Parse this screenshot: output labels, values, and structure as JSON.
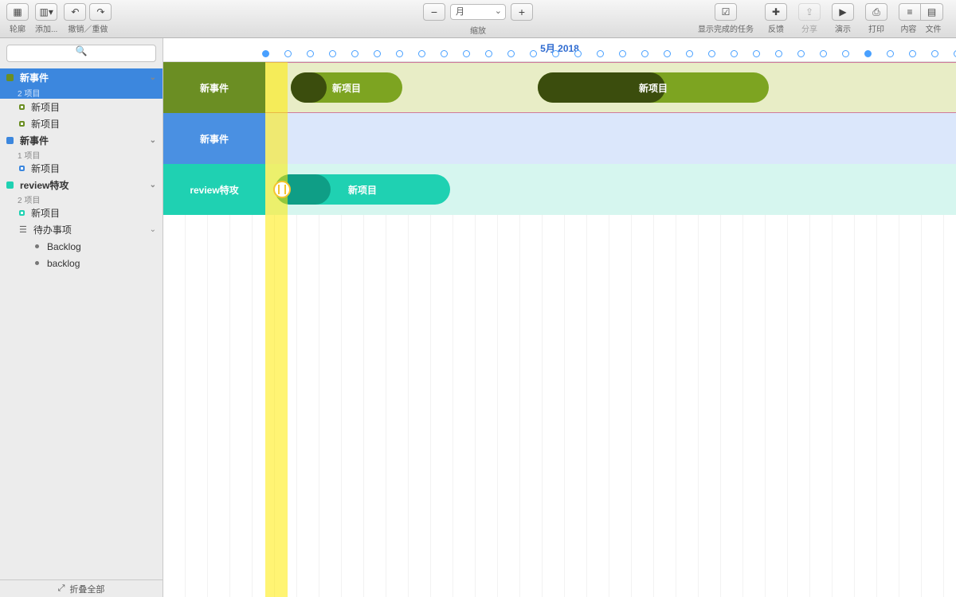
{
  "toolbar": {
    "outline_label": "轮廓",
    "add_label": "添加...",
    "undo_label": "撤销／重做",
    "zoom_label": "缩放",
    "zoom_value": "月",
    "show_completed_label": "显示完成的任务",
    "feedback_label": "反馈",
    "share_label": "分享",
    "present_label": "演示",
    "print_label": "打印",
    "content_label": "内容",
    "file_label": "文件"
  },
  "search": {
    "placeholder": ""
  },
  "sidebar": {
    "groups": [
      {
        "title": "新事件",
        "subtitle": "2 项目"
      },
      {
        "title": "新事件",
        "subtitle": "1 项目"
      },
      {
        "title": "review特攻",
        "subtitle": "2 项目"
      }
    ],
    "items": {
      "g1_i1": "新项目",
      "g1_i2": "新项目",
      "g2_i1": "新项目",
      "g3_i1": "新项目",
      "g3_todo": "待办事项",
      "g3_b1": "Backlog",
      "g3_b2": "backlog"
    },
    "footer": "折叠全部"
  },
  "timeline": {
    "month": "5月 2018",
    "rows": [
      {
        "label": "新事件"
      },
      {
        "label": "新事件"
      },
      {
        "label": "review特攻"
      }
    ],
    "bars": {
      "g_bar1": "新项目",
      "g_bar2": "新项目",
      "t_bar1": "新项目"
    }
  }
}
